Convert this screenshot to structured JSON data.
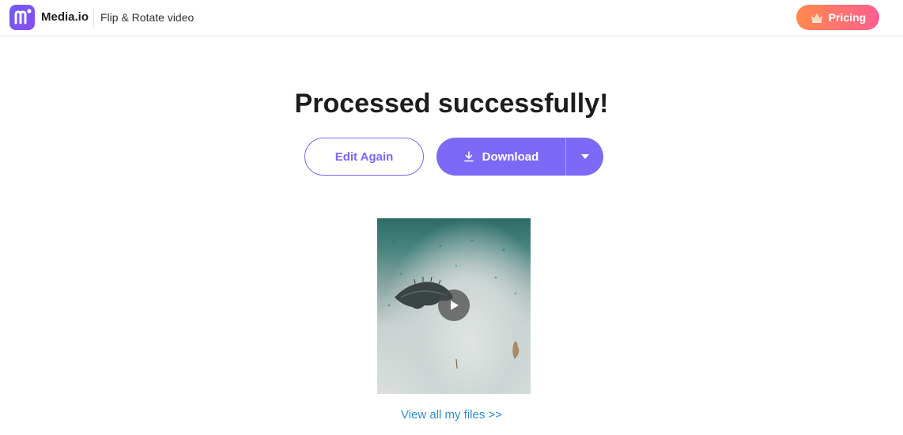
{
  "header": {
    "brand": "Media.io",
    "tool_name": "Flip & Rotate video",
    "logo_icon": "media-io-logo-icon",
    "pricing_label": "Pricing",
    "pricing_icon": "crown-icon"
  },
  "main": {
    "title": "Processed successfully!",
    "edit_again_label": "Edit Again",
    "download_label": "Download",
    "download_icon": "download-icon",
    "download_menu_icon": "caret-down-icon",
    "play_icon": "play-icon",
    "view_files_label": "View all my files >>"
  },
  "colors": {
    "accent": "#7c69f6",
    "pricing_gradient_start": "#ff8a4c",
    "pricing_gradient_end": "#ff5f8f",
    "link": "#2f8ccf"
  }
}
